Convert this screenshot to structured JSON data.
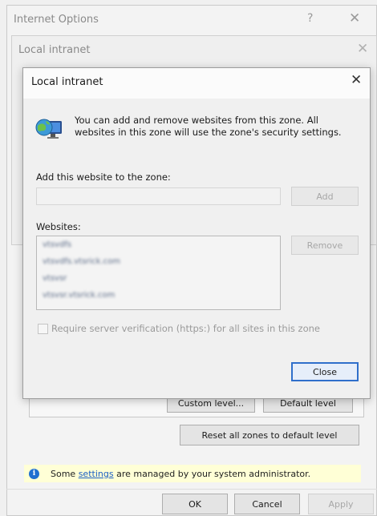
{
  "outer_window": {
    "title": "Internet Options",
    "help_glyph": "?",
    "close_glyph": "✕",
    "custom_level_label": "Custom level...",
    "default_level_label": "Default level",
    "reset_all_label": "Reset all zones to default level",
    "info_prefix": "Some ",
    "info_link": "settings",
    "info_suffix": " are managed by your system administrator.",
    "ok_label": "OK",
    "cancel_label": "Cancel",
    "apply_label": "Apply"
  },
  "middle_window": {
    "title": "Local intranet",
    "close_glyph": "✕"
  },
  "dialog": {
    "title": "Local intranet",
    "close_glyph": "✕",
    "description": "You can add and remove websites from this zone. All websites in this zone will use the zone's security settings.",
    "add_label": "Add this website to the zone:",
    "add_input_value": "",
    "add_button": "Add",
    "websites_label": "Websites:",
    "websites": [
      "vtsvdfs",
      "vtsvdfs.vtsrick.com",
      "vtsvsr",
      "vtsvsr.vtsrick.com"
    ],
    "remove_button": "Remove",
    "require_https_label": "Require server verification (https:) for all sites in this zone",
    "require_https_checked": false,
    "close_button": "Close"
  },
  "icons": {
    "zone_icon": "globe-monitor-icon",
    "info_icon": "info-icon"
  },
  "colors": {
    "accent": "#2f6fcb",
    "link": "#1c5fc4",
    "info_bar": "#ffffd6"
  }
}
